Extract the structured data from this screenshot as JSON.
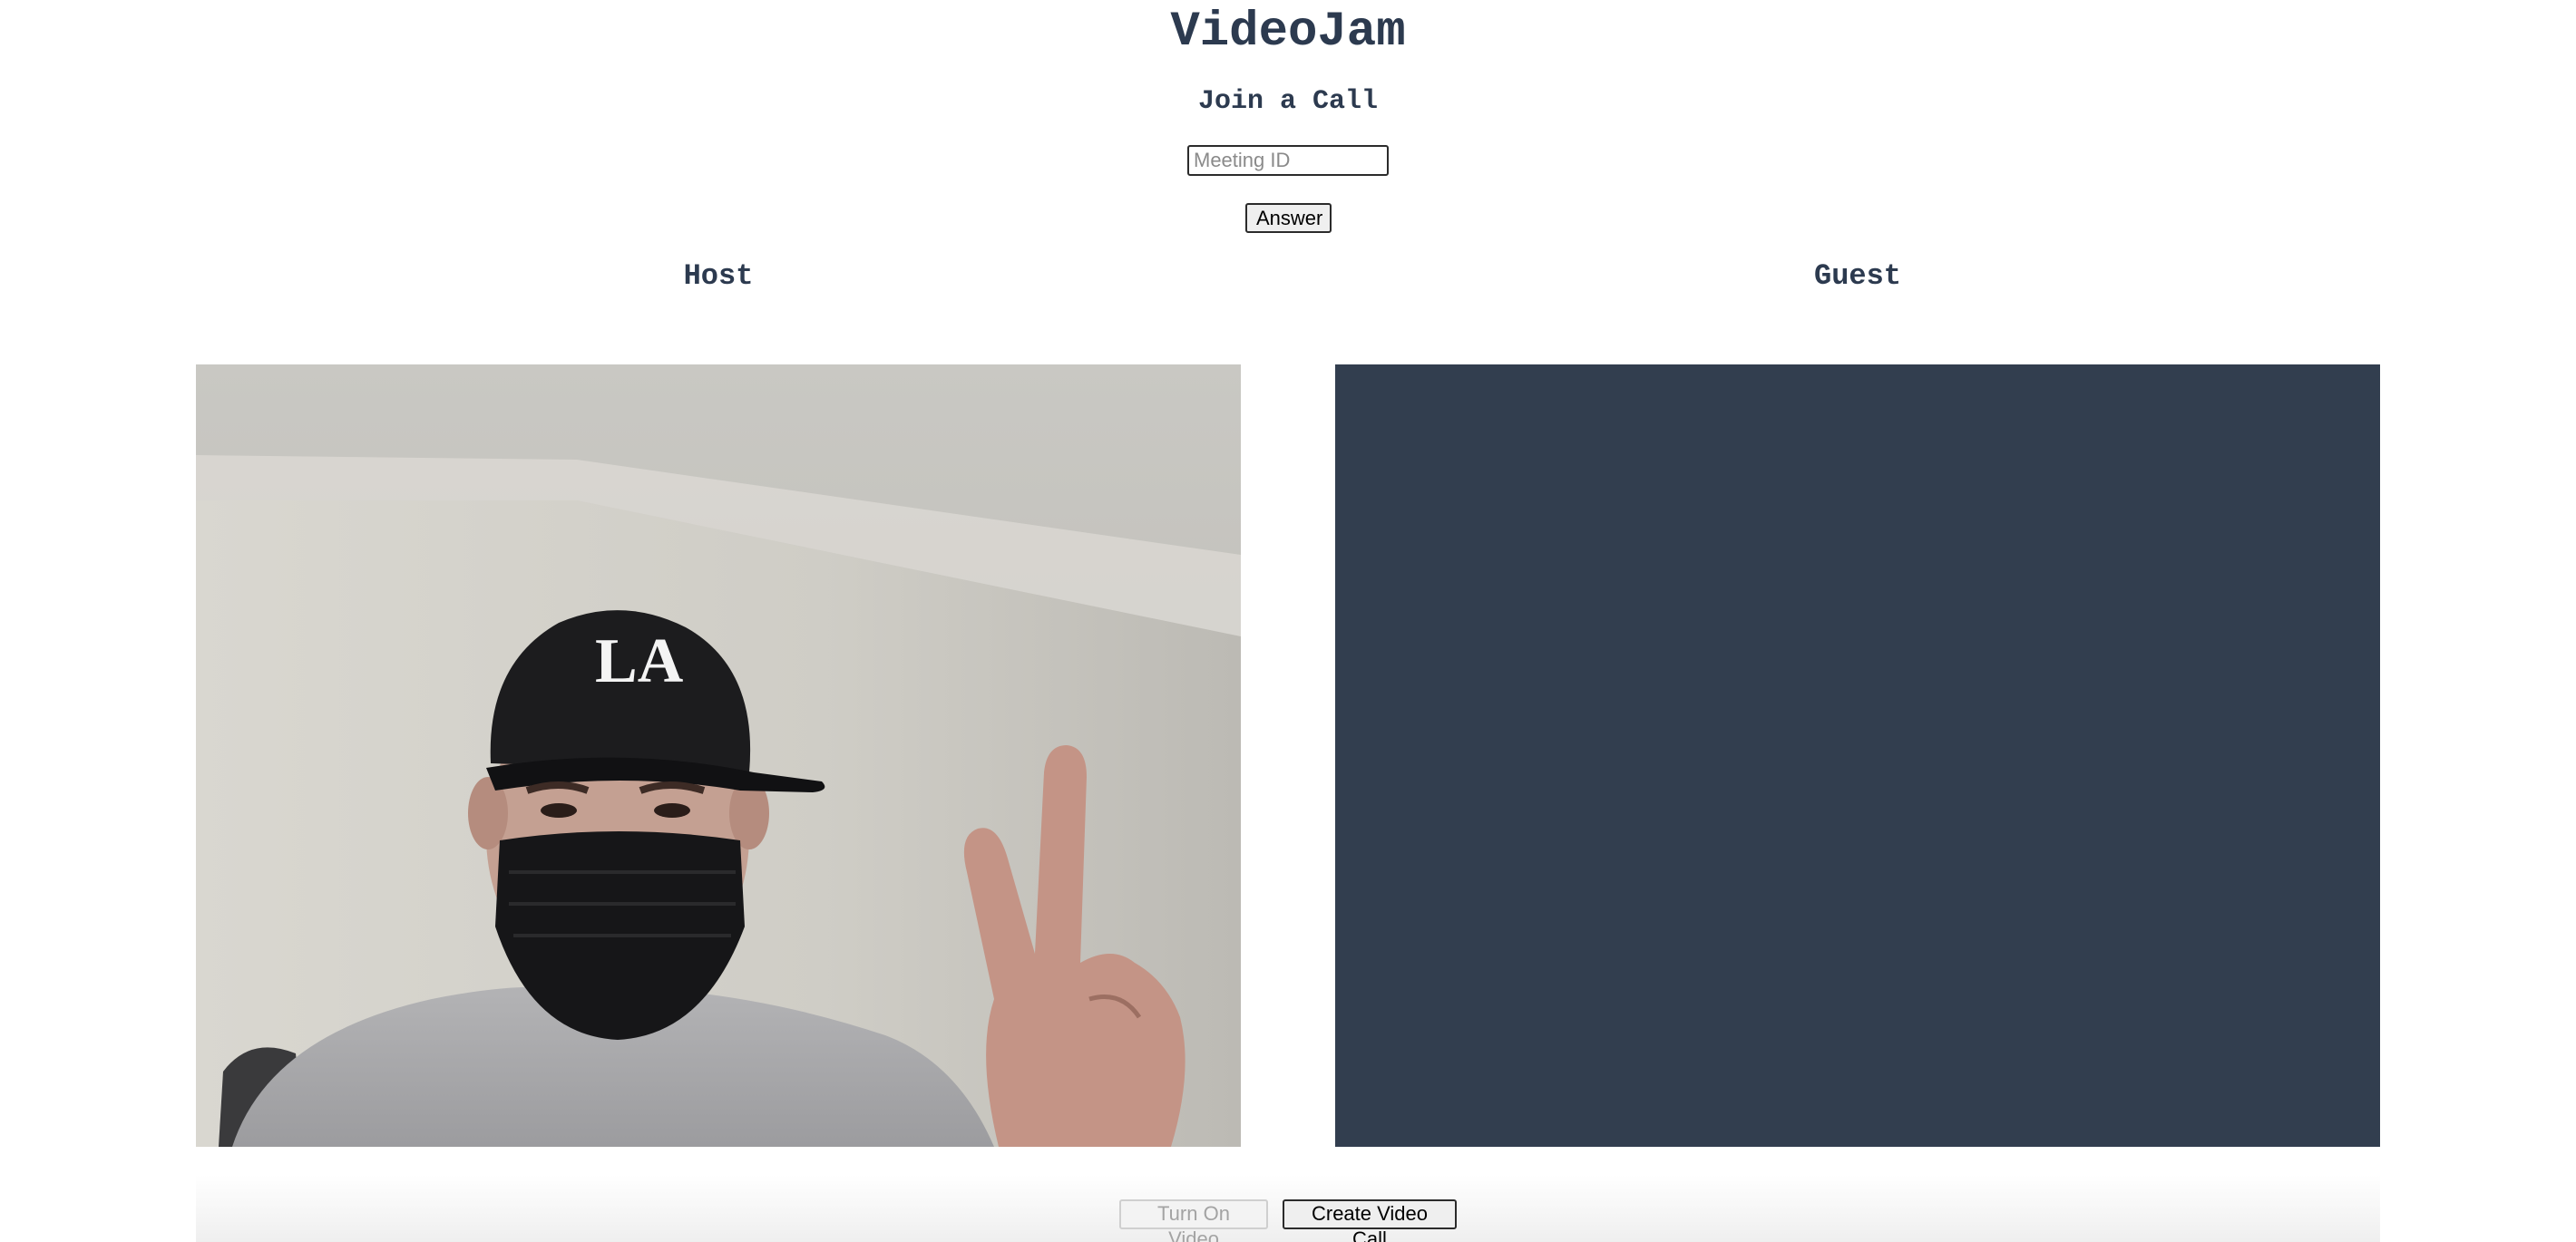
{
  "app": {
    "title": "VideoJam"
  },
  "join": {
    "heading": "Join a Call",
    "meeting_input": {
      "value": "",
      "placeholder": "Meeting ID"
    },
    "answer_label": "Answer"
  },
  "host": {
    "label": "Host"
  },
  "guest": {
    "label": "Guest"
  },
  "controls": {
    "turn_on_video_label": "Turn On Video",
    "turn_on_video_disabled": true,
    "create_call_label": "Create Video Call"
  },
  "colors": {
    "heading_text": "#2c3a4f",
    "guest_video_background": "#323e4f",
    "page_background": "#ffffff"
  }
}
